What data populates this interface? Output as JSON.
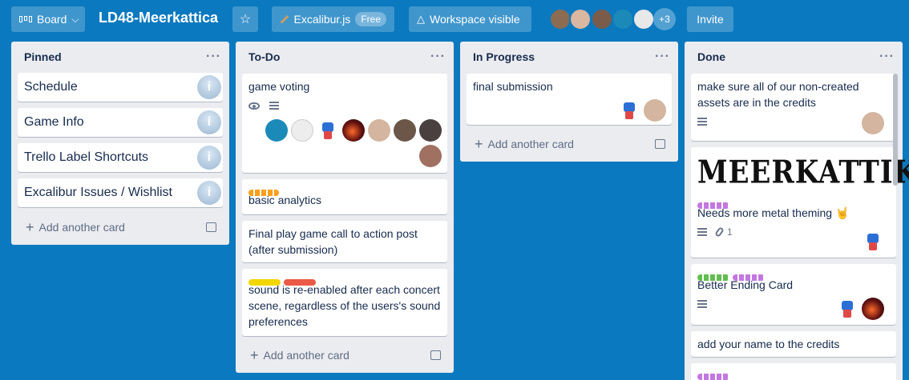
{
  "header": {
    "board_button": "Board",
    "board_title": "LD48-Meerkattica",
    "team_name": "Excalibur.js",
    "plan_badge": "Free",
    "visibility": "Workspace visible",
    "more_members": "+3",
    "invite": "Invite"
  },
  "lists": [
    {
      "title": "Pinned",
      "cards": [
        "Schedule",
        "Game Info",
        "Trello Label Shortcuts",
        "Excalibur Issues / Wishlist"
      ],
      "add_card": "Add another card"
    },
    {
      "title": "To-Do",
      "cards": [
        "game voting",
        "basic analytics",
        "Final play game call to action post (after submission)",
        "sound is re-enabled after each concert scene, regardless of the users's sound preferences"
      ],
      "add_card": "Add another card"
    },
    {
      "title": "In Progress",
      "cards": [
        "final submission"
      ],
      "add_card": "Add another card"
    },
    {
      "title": "Done",
      "cards": [
        "make sure all of our non-created assets are in the credits",
        "Needs more metal theming 🤘",
        "Better Ending Card",
        "add your name to the credits"
      ],
      "cover_text": "MEERKATTIKA",
      "attachments": "1"
    }
  ],
  "colors": {
    "board_bg": "#0a79bf",
    "orange": "#ff9f1a",
    "yellow": "#f2d600",
    "red": "#eb5a46",
    "purple": "#c377e0",
    "green": "#61bd4f"
  }
}
